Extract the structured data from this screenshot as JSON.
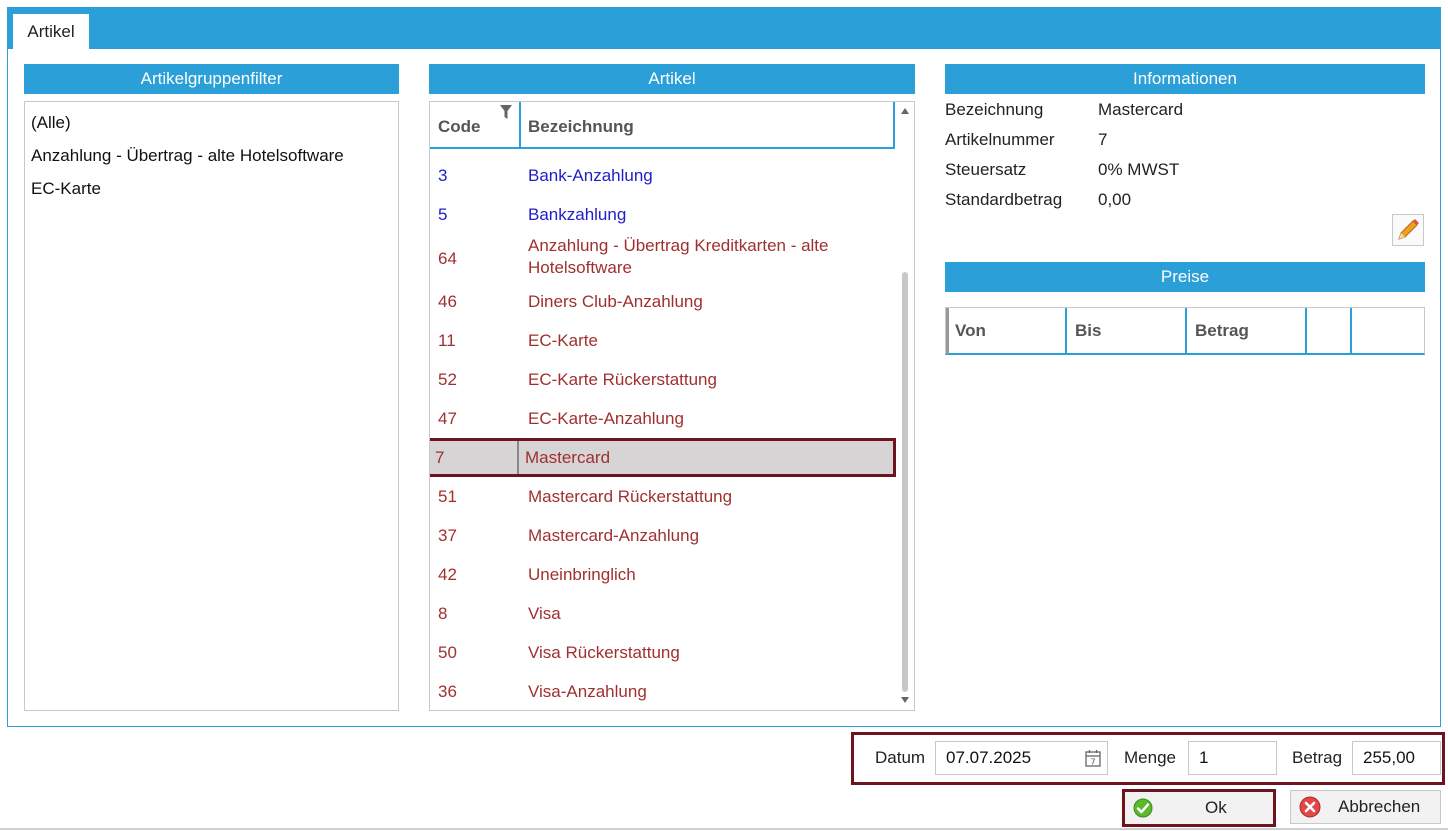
{
  "tab": {
    "label": "Artikel"
  },
  "groups": {
    "header": "Artikelgruppenfilter",
    "items": [
      "(Alle)",
      "Anzahlung - Übertrag - alte Hotelsoftware",
      "EC-Karte"
    ]
  },
  "articles": {
    "header": "Artikel",
    "col_code": "Code",
    "col_bez": "Bezeichnung",
    "rows": [
      {
        "code": "3",
        "name": "Bank-Anzahlung"
      },
      {
        "code": "5",
        "name": "Bankzahlung"
      },
      {
        "code": "64",
        "name": "Anzahlung - Übertrag Kreditkarten - alte Hotelsoftware"
      },
      {
        "code": "46",
        "name": "Diners Club-Anzahlung"
      },
      {
        "code": "11",
        "name": "EC-Karte"
      },
      {
        "code": "52",
        "name": "EC-Karte Rückerstattung"
      },
      {
        "code": "47",
        "name": "EC-Karte-Anzahlung"
      },
      {
        "code": "7",
        "name": "Mastercard"
      },
      {
        "code": "51",
        "name": "Mastercard Rückerstattung"
      },
      {
        "code": "37",
        "name": "Mastercard-Anzahlung"
      },
      {
        "code": "42",
        "name": "Uneinbringlich"
      },
      {
        "code": "8",
        "name": "Visa"
      },
      {
        "code": "50",
        "name": "Visa Rückerstattung"
      },
      {
        "code": "36",
        "name": "Visa-Anzahlung"
      }
    ]
  },
  "info": {
    "header": "Informationen",
    "bezeichnung_label": "Bezeichnung",
    "bezeichnung": "Mastercard",
    "artikelnummer_label": "Artikelnummer",
    "artikelnummer": "7",
    "steuersatz_label": "Steuersatz",
    "steuersatz": "0% MWST",
    "standardbetrag_label": "Standardbetrag",
    "standardbetrag": "0,00"
  },
  "prices": {
    "header": "Preise",
    "col_von": "Von",
    "col_bis": "Bis",
    "col_betrag": "Betrag"
  },
  "footer": {
    "datum_label": "Datum",
    "datum": "07.07.2025",
    "menge_label": "Menge",
    "menge": "1",
    "betrag_label": "Betrag",
    "betrag": "255,00",
    "ok_label": "Ok",
    "cancel_label": "Abbrechen"
  },
  "colors": {
    "accent": "#2a9fd8",
    "selection_border": "#6e1420",
    "link_blue": "#2020c8",
    "item_red": "#a03030"
  },
  "icons": [
    "filter-icon",
    "pencil-icon",
    "calendar-icon",
    "check-icon",
    "cancel-icon"
  ]
}
